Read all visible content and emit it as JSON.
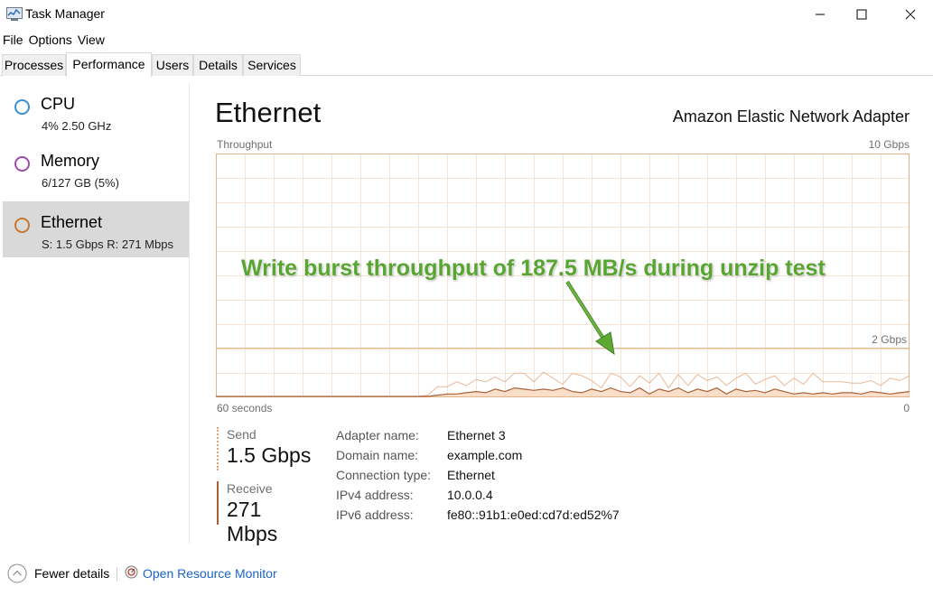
{
  "window": {
    "title": "Task Manager"
  },
  "menu": [
    "File",
    "Options",
    "View"
  ],
  "tabs": [
    "Processes",
    "Performance",
    "Users",
    "Details",
    "Services"
  ],
  "sidebar": {
    "items": [
      {
        "name": "CPU",
        "sub": "4%  2.50 GHz",
        "color": "#3c8fd0"
      },
      {
        "name": "Memory",
        "sub": "6/127 GB (5%)",
        "color": "#a04ab0"
      },
      {
        "name": "Ethernet",
        "sub": "S: 1.5 Gbps  R: 271 Mbps",
        "color": "#c6792f"
      }
    ]
  },
  "main": {
    "title": "Ethernet",
    "adapter": "Amazon Elastic Network Adapter",
    "graph": {
      "label_left_top": "Throughput",
      "label_right_top": "10 Gbps",
      "label_mid": "2 Gbps",
      "label_left_bottom": "60 seconds",
      "label_right_bottom": "0"
    },
    "send": {
      "label": "Send",
      "value": "1.5 Gbps"
    },
    "receive": {
      "label": "Receive",
      "value": "271 Mbps"
    },
    "details": [
      {
        "key": "Adapter name:",
        "value": "Ethernet 3"
      },
      {
        "key": "Domain name:",
        "value": "example.com"
      },
      {
        "key": "Connection type:",
        "value": "Ethernet"
      },
      {
        "key": "IPv4 address:",
        "value": "10.0.0.4"
      },
      {
        "key": "IPv6 address:",
        "value": "fe80::91b1:e0ed:cd7d:ed52%7"
      }
    ]
  },
  "annotation": "Write burst throughput of 187.5 MB/s during unzip test",
  "footer": {
    "fewer_details": "Fewer details",
    "open_resource_monitor": "Open Resource Monitor"
  },
  "chart_data": {
    "type": "line",
    "ylim": [
      0,
      2
    ],
    "series": [
      {
        "values": [
          0,
          0,
          0,
          0,
          0,
          0,
          0,
          0,
          0,
          0,
          0,
          0,
          0,
          0,
          0,
          0,
          0,
          0,
          0,
          0,
          0,
          0,
          0.05,
          0.4,
          0.4,
          0.6,
          0.45,
          0.7,
          0.6,
          0.8,
          0.6,
          0.95,
          0.95,
          0.6,
          1.0,
          0.75,
          0.5,
          0.95,
          0.85,
          0.65,
          0.35,
          0.95,
          0.8,
          0.4,
          0.85,
          0.55,
          0.95,
          0.35,
          0.9,
          0.45,
          0.9,
          0.65,
          0.8,
          0.45,
          0.75,
          0.95,
          0.5,
          0.7,
          0.85,
          0.45,
          0.75,
          0.5,
          0.95,
          0.6,
          0.6,
          0.6,
          0.55,
          0.55,
          0.65,
          0.45,
          0.75,
          0.65,
          0.85
        ]
      },
      {
        "values": [
          0,
          0,
          0,
          0,
          0,
          0,
          0,
          0,
          0,
          0,
          0,
          0,
          0,
          0,
          0,
          0,
          0,
          0,
          0,
          0,
          0,
          0,
          0,
          0.05,
          0.1,
          0.1,
          0.15,
          0.2,
          0.15,
          0.3,
          0.2,
          0.35,
          0.3,
          0.25,
          0.3,
          0.25,
          0.35,
          0.2,
          0.15,
          0.3,
          0.2,
          0.35,
          0.2,
          0.15,
          0.35,
          0.1,
          0.3,
          0.2,
          0.35,
          0.15,
          0.3,
          0.2,
          0.35,
          0.1,
          0.3,
          0.2,
          0.25,
          0.15,
          0.3,
          0.2,
          0.1,
          0.15,
          0.1,
          0.15,
          0.1,
          0.15,
          0.15,
          0.1,
          0.2,
          0.15,
          0.1,
          0.15,
          0.2
        ]
      }
    ]
  }
}
